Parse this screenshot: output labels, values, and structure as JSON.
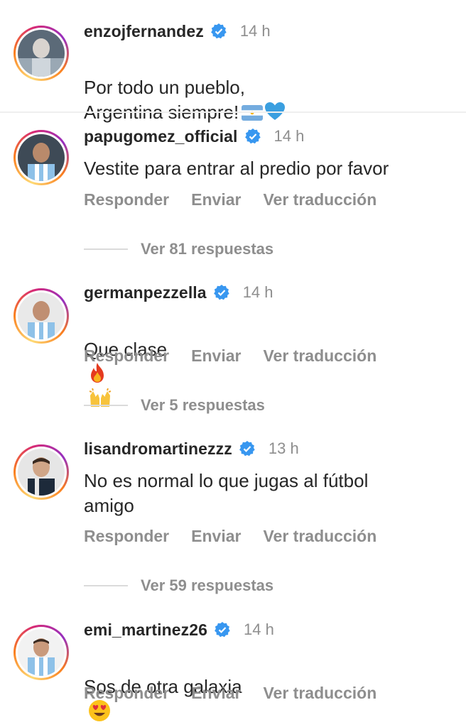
{
  "comments": [
    {
      "username": "enzojfernandez",
      "time": "14 h",
      "text": "Por todo un pueblo,\nArgentina siempre!",
      "emojis": [
        "argentina-flag",
        "blue-heart"
      ]
    },
    {
      "username": "papugomez_official",
      "time": "14 h",
      "text": "Vestite para entrar al predio por favor",
      "actions": [
        "Responder",
        "Enviar",
        "Ver traducción"
      ],
      "replies": "Ver 81 respuestas"
    },
    {
      "username": "germanpezzella",
      "time": "14 h",
      "text": "Que clase",
      "emojis": [
        "fire",
        "raised-hands"
      ],
      "actions": [
        "Responder",
        "Enviar",
        "Ver traducción"
      ],
      "replies": "Ver 5 respuestas"
    },
    {
      "username": "lisandromartinezzz",
      "time": "13 h",
      "text": "No es normal lo que jugas al fútbol\namigo",
      "actions": [
        "Responder",
        "Enviar",
        "Ver traducción"
      ],
      "replies": "Ver 59 respuestas"
    },
    {
      "username": "emi_martinez26",
      "time": "14 h",
      "text": "Sos de otra galaxia",
      "emojis": [
        "heart-eyes"
      ],
      "actions": [
        "Responder",
        "Enviar",
        "Ver traducción"
      ]
    }
  ],
  "colors": {
    "verified": "#3897f0",
    "muted": "#8e8e8e",
    "text": "#262626"
  }
}
